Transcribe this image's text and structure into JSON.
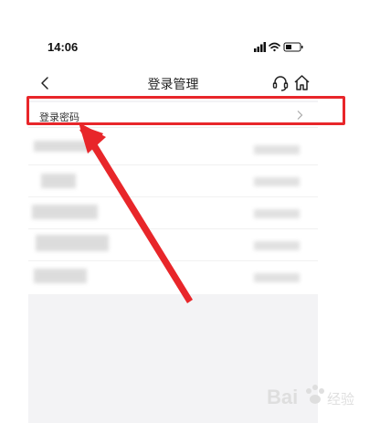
{
  "status_bar": {
    "time": "14:06"
  },
  "nav": {
    "title": "登录管理"
  },
  "rows": {
    "login_password": "登录密码"
  },
  "icons": {
    "back": "back-icon",
    "service": "headset-icon",
    "home": "home-icon",
    "chevron": "chevron-right-icon",
    "signal": "signal-icon",
    "wifi": "wifi-icon",
    "battery": "battery-icon"
  },
  "colors": {
    "highlight": "#e8262a",
    "nav_bg": "#ffffff",
    "page_bg": "#f3f3f5"
  }
}
